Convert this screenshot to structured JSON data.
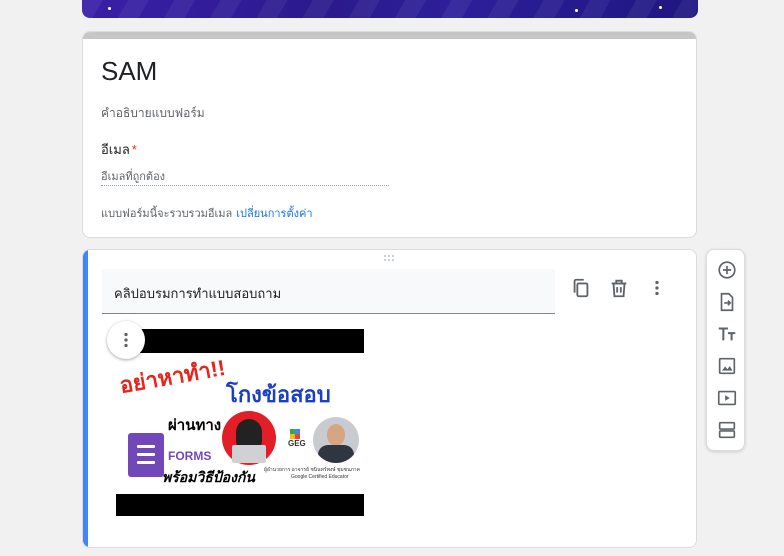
{
  "form": {
    "title": "SAM",
    "description": "คำอธิบายแบบฟอร์ม",
    "email_label": "อีเมล",
    "required_mark": "*",
    "email_placeholder": "อีเมลที่ถูกต้อง",
    "collect_note": "แบบฟอร์มนี้จะรวบรวมอีเมล",
    "change_settings_link": "เปลี่ยนการตั้งค่า"
  },
  "question": {
    "title": "คลิปอบรมการทำแบบสอบถาม",
    "thumbnail": {
      "headline_red": "อย่าหาทำ!!",
      "headline_blue": "โกงข้อสอบ",
      "via_text": "ผ่านทาง",
      "forms_label": "FORMS",
      "prevention_text": "พร้อมวิธีป้องกัน",
      "geg_label": "GEG",
      "caption_line1": "ผู้อำนวยการ อาจารย์ ชนินทร์พงษ์ ชุมชนภาค",
      "caption_line2": "Google Certified Educator"
    }
  },
  "icons": {
    "duplicate": "duplicate-icon",
    "delete": "trash-icon",
    "more": "more-vert-icon",
    "add_question": "add-circle-icon",
    "import_questions": "import-icon",
    "add_title": "title-icon",
    "add_image": "image-icon",
    "add_video": "video-icon",
    "add_section": "section-icon"
  },
  "colors": {
    "accent": "#4285f4",
    "link": "#1a73e8",
    "required": "#d93025",
    "banner": "#2a1a8c"
  }
}
